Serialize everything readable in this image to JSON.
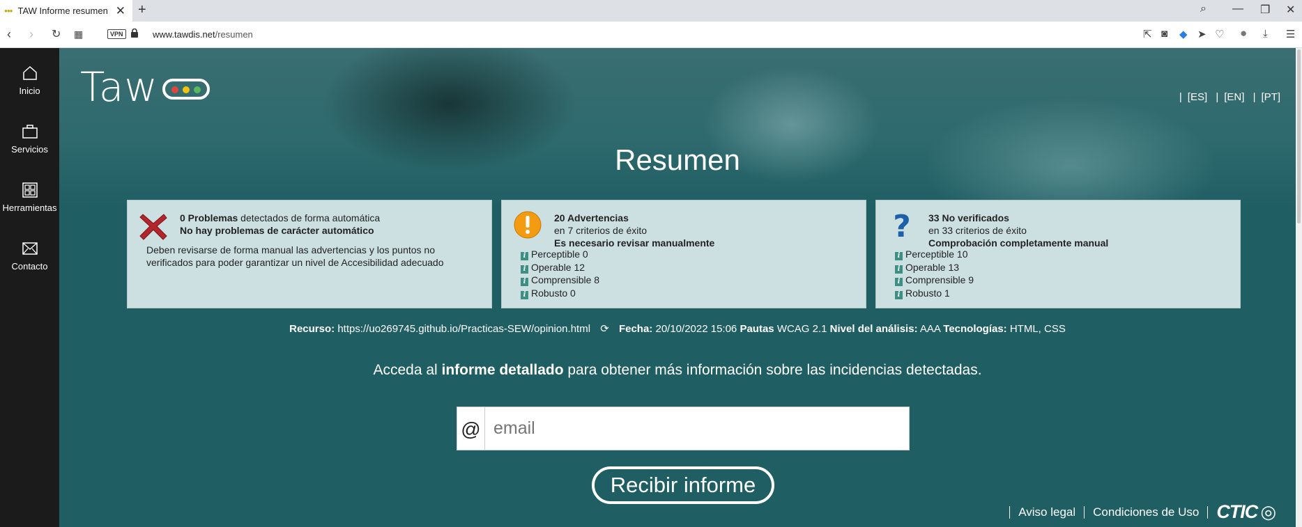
{
  "browser": {
    "tab_title": "TAW Informe resumen",
    "tab_close": "✕",
    "new_tab": "+",
    "url_host": "www.tawdis.net",
    "url_path": "/resumen",
    "vpn_label": "VPN"
  },
  "sidebar": {
    "items": [
      {
        "label": "Inicio",
        "icon": "home-icon"
      },
      {
        "label": "Servicios",
        "icon": "briefcase-icon"
      },
      {
        "label": "Herramientas",
        "icon": "grid-icon"
      },
      {
        "label": "Contacto",
        "icon": "mail-icon"
      }
    ]
  },
  "logo": {
    "text": "Taw",
    "dots": [
      "#e0463f",
      "#f1c40f",
      "#5cb85c"
    ]
  },
  "languages": [
    "[ES]",
    "[EN]",
    "[PT]"
  ],
  "page_title": "Resumen",
  "cards": [
    {
      "icon": "error-x-icon",
      "count_label": "0 Problemas",
      "line1_rest": " detectados de forma automática",
      "line2": "No hay problemas de carácter automático",
      "body": "Deben revisarse de forma manual las advertencias y los puntos no verificados para poder garantizar un nivel de Accesibilidad adecuado"
    },
    {
      "icon": "warning-icon",
      "count_label": "20 Advertencias",
      "line2": "en 7 criterios de éxito",
      "line3": "Es necesario revisar manualmente",
      "items": [
        "Perceptible 0",
        "Operable 12",
        "Comprensible 8",
        "Robusto 0"
      ]
    },
    {
      "icon": "question-icon",
      "count_label": "33 No verificados",
      "line2": "en 33 criterios de éxito",
      "line3": "Comprobación completamente manual",
      "items": [
        "Perceptible 10",
        "Operable 13",
        "Comprensible 9",
        "Robusto 1"
      ]
    }
  ],
  "meta": {
    "recurso_label": "Recurso:",
    "recurso_value": "https://uo269745.github.io/Practicas-SEW/opinion.html",
    "fecha_label": "Fecha:",
    "fecha_value": "20/10/2022 15:06",
    "pautas_label": "Pautas",
    "pautas_value": "WCAG 2.1",
    "nivel_label": "Nivel del análisis:",
    "nivel_value": "AAA",
    "tecnologias_label": "Tecnologías:",
    "tecnologias_value": "HTML, CSS"
  },
  "cta": {
    "prefix": "Acceda al ",
    "bold": "informe detallado",
    "suffix": " para obtener más información sobre las incidencias detectadas."
  },
  "email": {
    "at": "@",
    "placeholder": "email"
  },
  "submit_label": "Recibir informe",
  "footer": {
    "aviso": "Aviso legal",
    "condiciones": "Condiciones de Uso",
    "brand": "CTIC"
  }
}
